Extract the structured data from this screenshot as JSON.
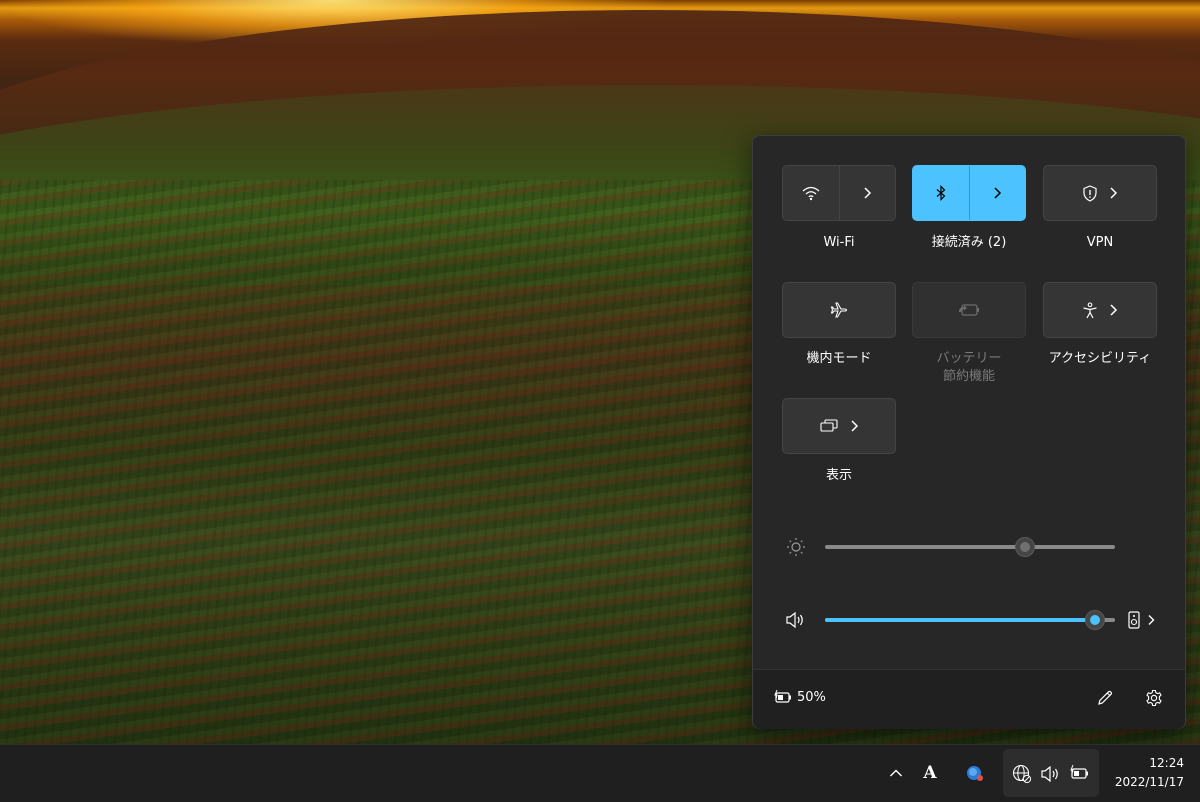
{
  "quick_settings": {
    "tiles": {
      "wifi": {
        "label": "Wi-Fi"
      },
      "bluetooth": {
        "label": "接続済み (2)"
      },
      "vpn": {
        "label": "VPN"
      },
      "airplane": {
        "label": "機内モード"
      },
      "battery_saver": {
        "label_line1": "バッテリー",
        "label_line2": "節約機能"
      },
      "accessibility": {
        "label": "アクセシビリティ"
      },
      "display": {
        "label": "表示"
      }
    },
    "brightness": {
      "level": 0.69
    },
    "volume": {
      "level": 0.93
    },
    "footer": {
      "battery_percent": "50%"
    }
  },
  "taskbar": {
    "ime_indicator": "A",
    "clock": {
      "time": "12:24",
      "date": "2022/11/17"
    }
  },
  "colors": {
    "accent": "#4cc2ff",
    "panel_bg": "#272727",
    "taskbar_bg": "#1f1f1f"
  },
  "icons": [
    "wifi-icon",
    "bluetooth-icon",
    "vpn-shield-icon",
    "airplane-icon",
    "battery-saver-icon",
    "accessibility-icon",
    "display-icon",
    "brightness-icon",
    "volume-icon",
    "audio-output-icon",
    "battery-icon",
    "edit-pencil-icon",
    "settings-gear-icon",
    "chevron-up-icon",
    "copilot-icon",
    "network-globe-icon",
    "chevron-right-icon"
  ]
}
